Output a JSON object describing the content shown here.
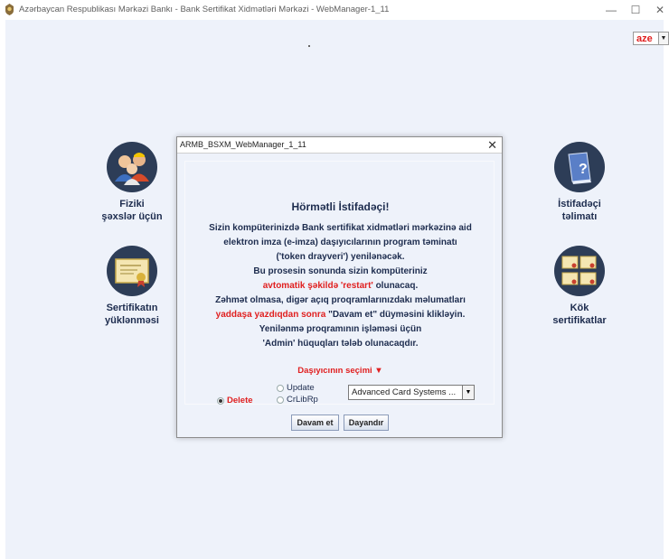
{
  "window": {
    "title": "Azərbaycan Respublikası Mərkəzi Bankı - Bank Sertifikat Xidmətləri Mərkəzi - WebManager-1_11",
    "minimize": "—",
    "maximize": "☐",
    "close": "✕"
  },
  "language": {
    "value": "aze",
    "arrow": "▼"
  },
  "left_menu": [
    {
      "label_line1": "Fiziki",
      "label_line2": "şəxslər üçün"
    },
    {
      "label_line1": "Sertifikatın",
      "label_line2": "yüklənməsi"
    }
  ],
  "right_menu": [
    {
      "label_line1": "İstifadəçi",
      "label_line2": "təlimatı"
    },
    {
      "label_line1": "Kök",
      "label_line2": "sertifikatlar"
    }
  ],
  "dialog": {
    "title": "ARMB_BSXM_WebManager_1_11",
    "close": "✕",
    "greeting": "Hörmətli İstifadəçi!",
    "lines": {
      "l1": "Sizin kompüterinizdə Bank sertifikat xidmətləri mərkəzinə aid",
      "l2": "elektron imza (e-imza) daşıyıcılarının program təminatı",
      "l3": "('token drayveri') yenilənəcək.",
      "l4": "Bu prosesin sonunda sizin kompüteriniz",
      "l5_red": "avtomatik şəkildə 'restart'",
      "l5_rest": " olunacaq.",
      "l6": "Zəhmət olmasa, digər açıq proqramlarınızdakı məlumatları",
      "l7_red": "yaddaşa yazdıqdan sonra",
      "l7_rest": " \"Davam et\" düyməsini klikləyin.",
      "l8": "Yenilənmə proqramının işləməsi üçün",
      "l9": "'Admin' hüquqları tələb olunacaqdır."
    },
    "carrier_choice_label": "Daşıyıcının seçimi ▼",
    "radios": {
      "delete": "Delete",
      "update": "Update",
      "crlibrp": "CrLibRp",
      "selected": "Delete"
    },
    "carrier_select": {
      "value": "Advanced Card Systems ...",
      "arrow": "▼"
    },
    "buttons": {
      "continue": "Davam et",
      "stop": "Dayandır"
    }
  },
  "colors": {
    "accent_red": "#e02020",
    "text_navy": "#1d2c4e",
    "background": "#eef2fa"
  },
  "icons": [
    "app-icon",
    "people-icon",
    "help-book-icon",
    "certificate-icon",
    "root-certificates-icon",
    "caret-down-icon"
  ]
}
